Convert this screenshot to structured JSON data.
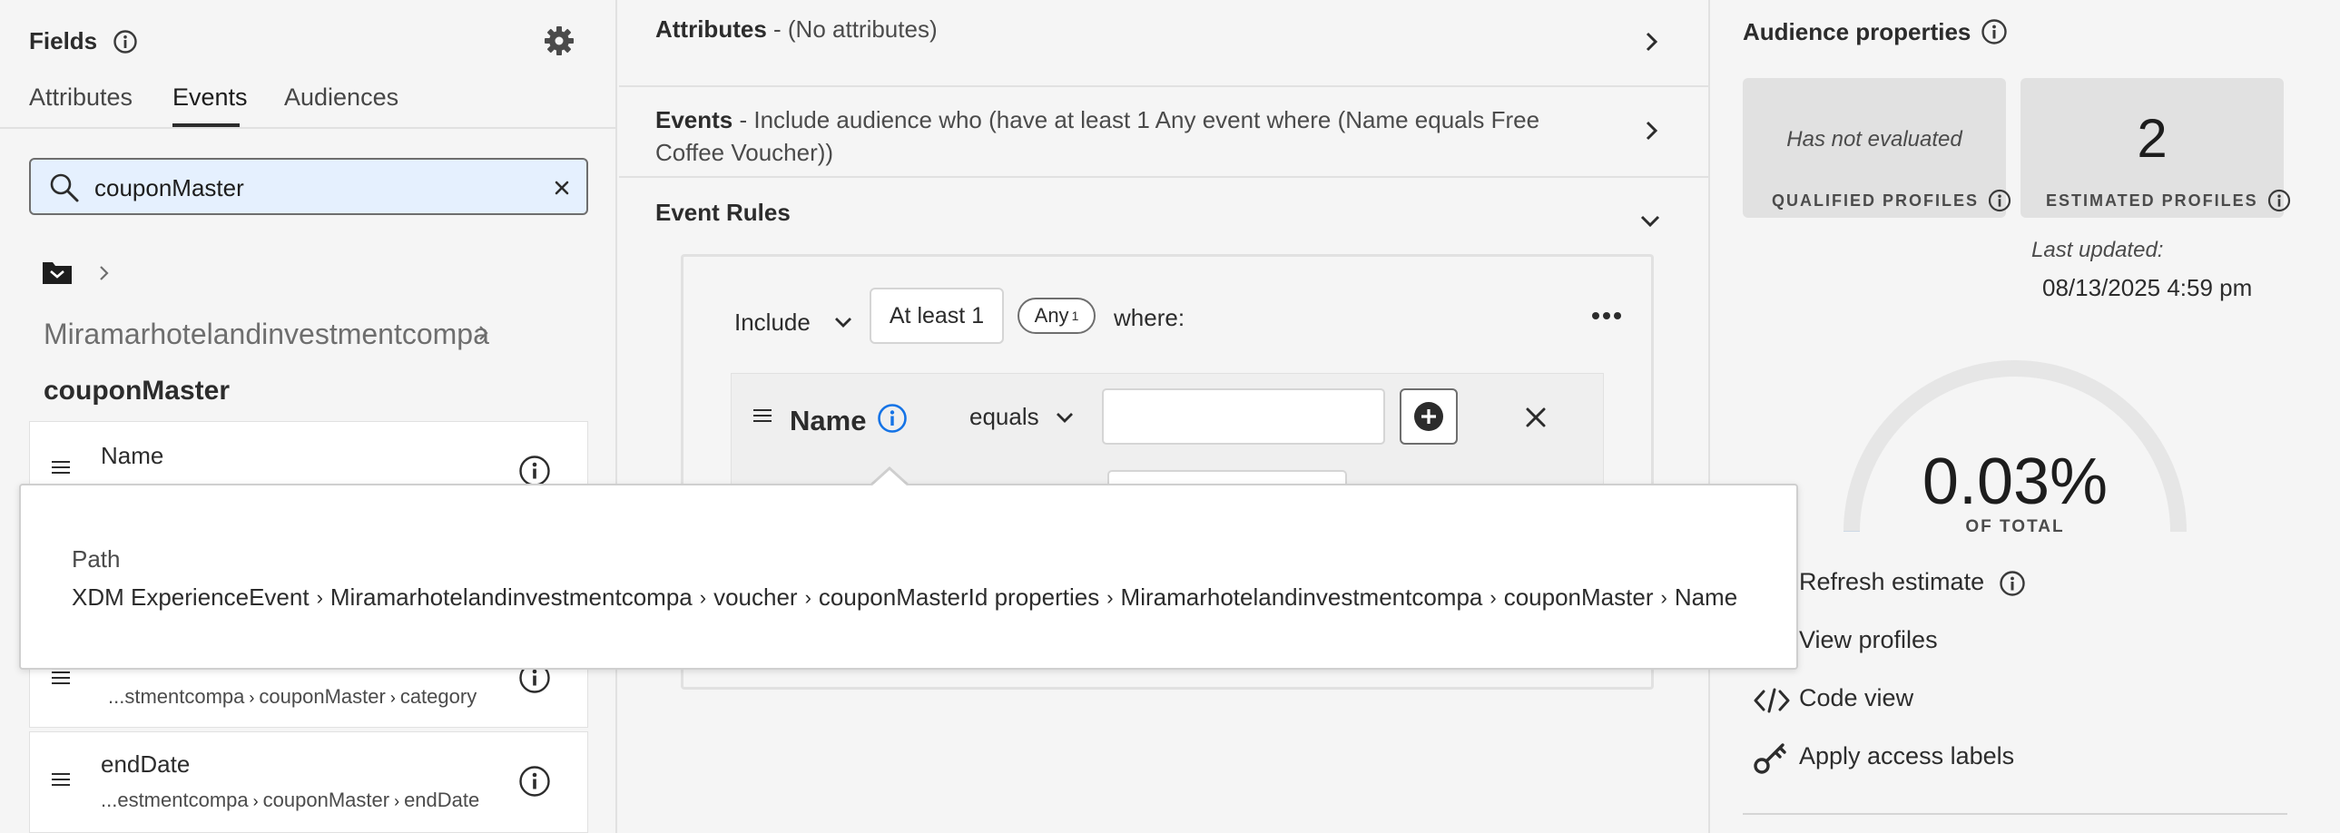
{
  "left": {
    "title": "Fields",
    "tabs": [
      {
        "label": "Attributes",
        "active": false
      },
      {
        "label": "Events",
        "active": true
      },
      {
        "label": "Audiences",
        "active": false
      }
    ],
    "search": {
      "value": "couponMaster"
    },
    "path_segment": "Miramarhotelandinvestmentcompa",
    "schema_title": "couponMaster",
    "fields": [
      {
        "name": "Name",
        "path": ""
      },
      {
        "name": "",
        "path": "...stmentcompa",
        "crumbs": [
          "couponMaster",
          "category"
        ]
      },
      {
        "name": "endDate",
        "path": "...estmentcompa",
        "crumbs": [
          "couponMaster",
          "endDate"
        ]
      }
    ]
  },
  "center": {
    "attributes_row": {
      "title": "Attributes",
      "text": " - (No attributes)"
    },
    "events_row": {
      "title": "Events",
      "text": " - Include audience who (have at least 1 Any event where (Name equals Free Coffee Voucher))"
    },
    "event_rules": {
      "title": "Event Rules"
    },
    "rule": {
      "include_label": "Include",
      "count_label": "At least 1",
      "any_label": "Any",
      "any_superscript": "1",
      "where_label": "where:",
      "condition": {
        "field": "Name",
        "operator": "equals",
        "value": ""
      }
    }
  },
  "right": {
    "title": "Audience properties",
    "qualified": {
      "value": "Has not evaluated",
      "label": "QUALIFIED PROFILES"
    },
    "estimated": {
      "value": "2",
      "label": "ESTIMATED PROFILES"
    },
    "last_updated_label": "Last updated:",
    "last_updated_value": "08/13/2025 4:59 pm",
    "gauge": {
      "percent_text": "0.03%",
      "sub_label": "OF TOTAL",
      "fraction": 0.0003
    },
    "actions": [
      {
        "label": "Refresh estimate",
        "icon": "refresh-icon"
      },
      {
        "label": "View profiles",
        "icon": "view-icon"
      },
      {
        "label": "Code view",
        "icon": "code-icon"
      },
      {
        "label": "Apply access labels",
        "icon": "key-icon"
      }
    ]
  },
  "tooltip": {
    "label": "Path",
    "crumbs": [
      "XDM ExperienceEvent",
      "Miramarhotelandinvestmentcompa",
      "voucher",
      "couponMasterId properties",
      "Miramarhotelandinvestmentcompa",
      "couponMaster",
      "Name"
    ]
  },
  "colors": {
    "accent_blue": "#1473e6",
    "search_bg": "#e5f0fe",
    "card_bg": "#e1e1e1"
  }
}
